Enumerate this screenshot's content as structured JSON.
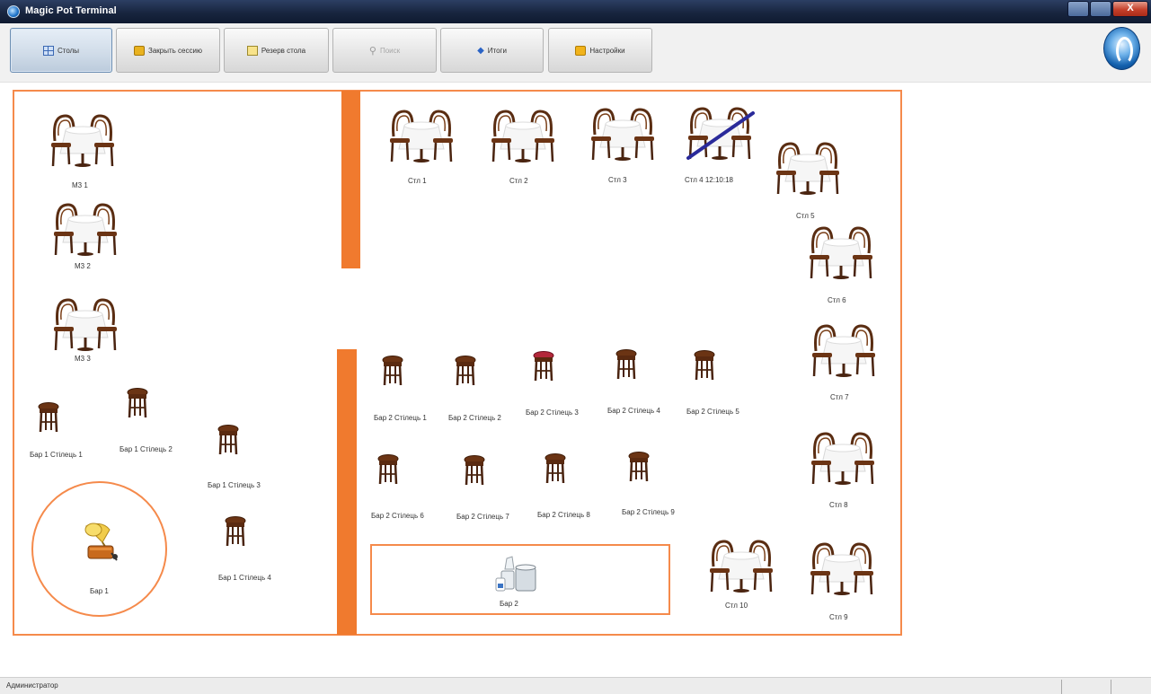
{
  "window": {
    "title": "Magic Pot Terminal",
    "close_glyph": "X"
  },
  "toolbar": {
    "buttons": [
      {
        "label": "Столы",
        "icon": "grid-icon",
        "state": "active"
      },
      {
        "label": "Закрыть сессию",
        "icon": "lock-icon",
        "state": "normal"
      },
      {
        "label": "Резерв стола",
        "icon": "note-icon",
        "state": "normal"
      },
      {
        "label": "Поиск",
        "icon": "search-icon",
        "state": "disabled"
      },
      {
        "label": "Итоги",
        "icon": "arrows-icon",
        "state": "normal"
      },
      {
        "label": "Настройки",
        "icon": "wrench-icon",
        "state": "normal"
      }
    ]
  },
  "hall": {
    "tables": [
      {
        "label": "М3 1"
      },
      {
        "label": "М3 2"
      },
      {
        "label": "М3 3"
      },
      {
        "label": "Стл 1"
      },
      {
        "label": "Стл 2"
      },
      {
        "label": "Стл 3"
      },
      {
        "label": "Стл 4 12:10:18",
        "reserved": true
      },
      {
        "label": "Стл 5"
      },
      {
        "label": "Стл 6"
      },
      {
        "label": "Стл 7"
      },
      {
        "label": "Стл 8"
      },
      {
        "label": "Стл 9"
      },
      {
        "label": "Стл 10"
      }
    ],
    "stools": [
      {
        "label": "Бар 1 Стілець 1"
      },
      {
        "label": "Бар 1 Стілець 2"
      },
      {
        "label": "Бар 1 Стілець 3"
      },
      {
        "label": "Бар 1 Стілець 4"
      },
      {
        "label": "Бар 2 Стілець 1"
      },
      {
        "label": "Бар 2 Стілець 2"
      },
      {
        "label": "Бар 2 Стілець 3",
        "occupied": true
      },
      {
        "label": "Бар 2 Стілець 4"
      },
      {
        "label": "Бар 2 Стілець 5"
      },
      {
        "label": "Бар 2 Стілець 6"
      },
      {
        "label": "Бар 2 Стілець 7"
      },
      {
        "label": "Бар 2 Стілець 8"
      },
      {
        "label": "Бар 2 Стілець 9"
      }
    ],
    "bars": [
      {
        "label": "Бар 1",
        "icon": "gramophone-icon"
      },
      {
        "label": "Бар 2",
        "icon": "cups-icon"
      }
    ]
  },
  "colors": {
    "hall_border": "#f58a4b",
    "wall": "#f07a2e",
    "reserved_strike": "#2a2a9a",
    "occupied_stool": "#b3283a"
  },
  "status": {
    "user": "Администратор"
  }
}
